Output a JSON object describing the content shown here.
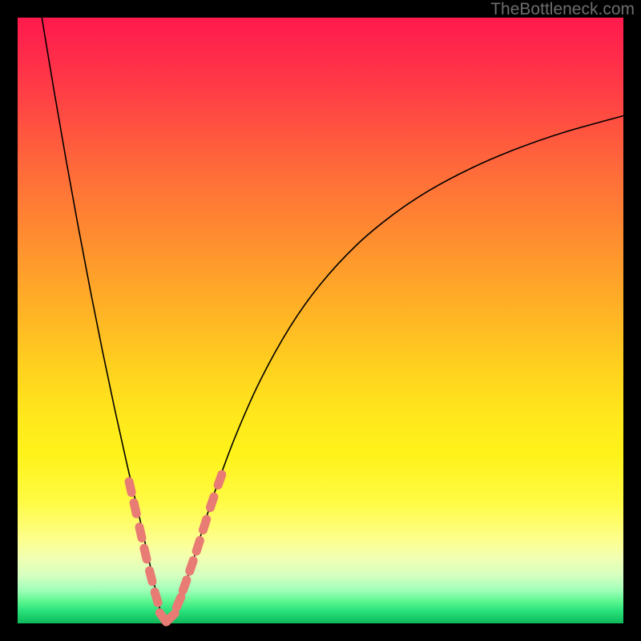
{
  "watermark": "TheBottleneck.com",
  "chart_data": {
    "type": "line",
    "title": "",
    "xlabel": "",
    "ylabel": "",
    "xlim": [
      0,
      100
    ],
    "ylim": [
      0,
      100
    ],
    "grid": false,
    "legend": false,
    "curve": {
      "name": "bottleneck-curve",
      "description": "V-shaped bottleneck curve with minimum near x≈24",
      "points": [
        {
          "x": 4.0,
          "y": 100.0
        },
        {
          "x": 6.0,
          "y": 88.0
        },
        {
          "x": 8.0,
          "y": 76.5
        },
        {
          "x": 10.0,
          "y": 65.5
        },
        {
          "x": 12.0,
          "y": 55.0
        },
        {
          "x": 14.0,
          "y": 45.0
        },
        {
          "x": 16.0,
          "y": 35.5
        },
        {
          "x": 18.0,
          "y": 26.5
        },
        {
          "x": 20.0,
          "y": 18.0
        },
        {
          "x": 21.0,
          "y": 13.5
        },
        {
          "x": 22.0,
          "y": 9.0
        },
        {
          "x": 23.0,
          "y": 4.5
        },
        {
          "x": 23.8,
          "y": 1.2
        },
        {
          "x": 24.3,
          "y": 0.2
        },
        {
          "x": 25.0,
          "y": 0.2
        },
        {
          "x": 25.6,
          "y": 1.0
        },
        {
          "x": 27.0,
          "y": 4.5
        },
        {
          "x": 29.0,
          "y": 10.5
        },
        {
          "x": 31.0,
          "y": 17.0
        },
        {
          "x": 33.0,
          "y": 23.0
        },
        {
          "x": 36.0,
          "y": 31.0
        },
        {
          "x": 40.0,
          "y": 40.0
        },
        {
          "x": 45.0,
          "y": 49.0
        },
        {
          "x": 50.0,
          "y": 56.0
        },
        {
          "x": 56.0,
          "y": 62.5
        },
        {
          "x": 62.0,
          "y": 67.5
        },
        {
          "x": 68.0,
          "y": 71.5
        },
        {
          "x": 75.0,
          "y": 75.2
        },
        {
          "x": 82.0,
          "y": 78.2
        },
        {
          "x": 90.0,
          "y": 81.0
        },
        {
          "x": 100.0,
          "y": 83.8
        }
      ]
    },
    "series": [
      {
        "name": "highlighted-points",
        "type": "scatter",
        "marker": "rounded-bar",
        "color": "#e87b74",
        "points": [
          {
            "x": 18.6,
            "y": 22.5
          },
          {
            "x": 19.4,
            "y": 19.0
          },
          {
            "x": 20.3,
            "y": 15.0
          },
          {
            "x": 21.1,
            "y": 11.5
          },
          {
            "x": 22.0,
            "y": 7.8
          },
          {
            "x": 22.9,
            "y": 4.3
          },
          {
            "x": 24.0,
            "y": 1.0
          },
          {
            "x": 25.3,
            "y": 1.0
          },
          {
            "x": 26.6,
            "y": 3.5
          },
          {
            "x": 27.6,
            "y": 6.3
          },
          {
            "x": 28.7,
            "y": 9.5
          },
          {
            "x": 29.8,
            "y": 12.8
          },
          {
            "x": 30.9,
            "y": 16.3
          },
          {
            "x": 32.1,
            "y": 20.0
          },
          {
            "x": 33.4,
            "y": 23.7
          }
        ]
      }
    ]
  }
}
